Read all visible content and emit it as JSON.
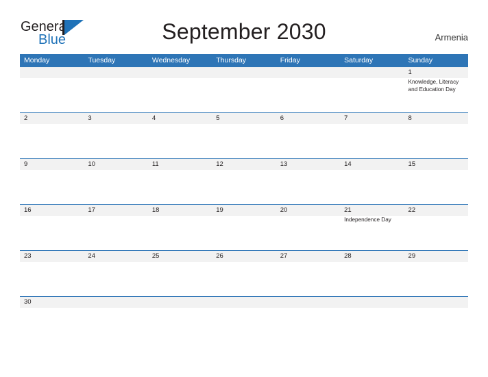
{
  "brand": {
    "name_part1": "General",
    "name_part2": "Blue",
    "mark": "flag-triangle-icon",
    "color_primary": "#1f72b8",
    "color_text": "#231f20"
  },
  "header": {
    "title": "September 2030",
    "country": "Armenia"
  },
  "theme": {
    "header_blue": "#2e75b6",
    "row_line_blue": "#2e75b6",
    "date_band_gray": "#f2f2f2",
    "cell_white": "#ffffff",
    "text": "#231f20"
  },
  "calendar": {
    "weekdays": [
      "Monday",
      "Tuesday",
      "Wednesday",
      "Thursday",
      "Friday",
      "Saturday",
      "Sunday"
    ],
    "weeks": [
      [
        {
          "day": "",
          "event": ""
        },
        {
          "day": "",
          "event": ""
        },
        {
          "day": "",
          "event": ""
        },
        {
          "day": "",
          "event": ""
        },
        {
          "day": "",
          "event": ""
        },
        {
          "day": "",
          "event": ""
        },
        {
          "day": "1",
          "event": "Knowledge, Literacy and Education Day"
        }
      ],
      [
        {
          "day": "2",
          "event": ""
        },
        {
          "day": "3",
          "event": ""
        },
        {
          "day": "4",
          "event": ""
        },
        {
          "day": "5",
          "event": ""
        },
        {
          "day": "6",
          "event": ""
        },
        {
          "day": "7",
          "event": ""
        },
        {
          "day": "8",
          "event": ""
        }
      ],
      [
        {
          "day": "9",
          "event": ""
        },
        {
          "day": "10",
          "event": ""
        },
        {
          "day": "11",
          "event": ""
        },
        {
          "day": "12",
          "event": ""
        },
        {
          "day": "13",
          "event": ""
        },
        {
          "day": "14",
          "event": ""
        },
        {
          "day": "15",
          "event": ""
        }
      ],
      [
        {
          "day": "16",
          "event": ""
        },
        {
          "day": "17",
          "event": ""
        },
        {
          "day": "18",
          "event": ""
        },
        {
          "day": "19",
          "event": ""
        },
        {
          "day": "20",
          "event": ""
        },
        {
          "day": "21",
          "event": "Independence Day"
        },
        {
          "day": "22",
          "event": ""
        }
      ],
      [
        {
          "day": "23",
          "event": ""
        },
        {
          "day": "24",
          "event": ""
        },
        {
          "day": "25",
          "event": ""
        },
        {
          "day": "26",
          "event": ""
        },
        {
          "day": "27",
          "event": ""
        },
        {
          "day": "28",
          "event": ""
        },
        {
          "day": "29",
          "event": ""
        }
      ],
      [
        {
          "day": "30",
          "event": ""
        },
        {
          "day": "",
          "event": ""
        },
        {
          "day": "",
          "event": ""
        },
        {
          "day": "",
          "event": ""
        },
        {
          "day": "",
          "event": ""
        },
        {
          "day": "",
          "event": ""
        },
        {
          "day": "",
          "event": ""
        }
      ]
    ]
  }
}
